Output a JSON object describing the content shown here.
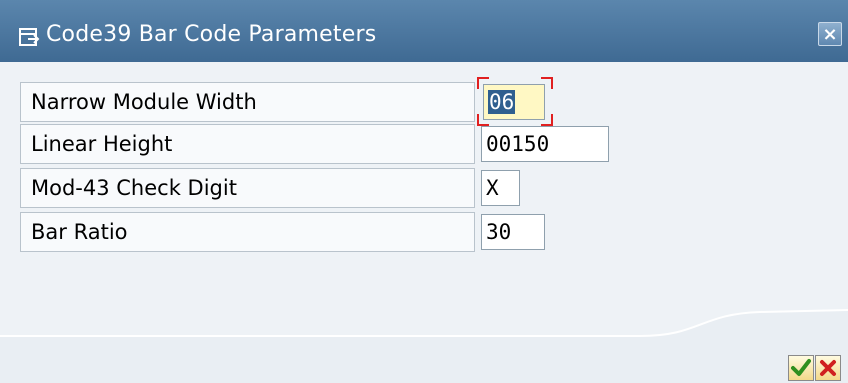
{
  "window": {
    "title": "Code39 Bar Code Parameters",
    "title_icon": "dialog-icon",
    "close_label": "×"
  },
  "fields": [
    {
      "label": "Narrow Module Width",
      "value": "06"
    },
    {
      "label": "Linear Height",
      "value": "00150"
    },
    {
      "label": "Mod-43 Check Digit",
      "value": "X"
    },
    {
      "label": "Bar Ratio",
      "value": "30"
    }
  ],
  "buttons": {
    "confirm_icon": "checkmark-icon",
    "cancel_icon": "cancel-x-icon"
  },
  "colors": {
    "titlebar": "#4a769f",
    "focus_corners": "#e02020",
    "selection": "#2f5f8f"
  }
}
